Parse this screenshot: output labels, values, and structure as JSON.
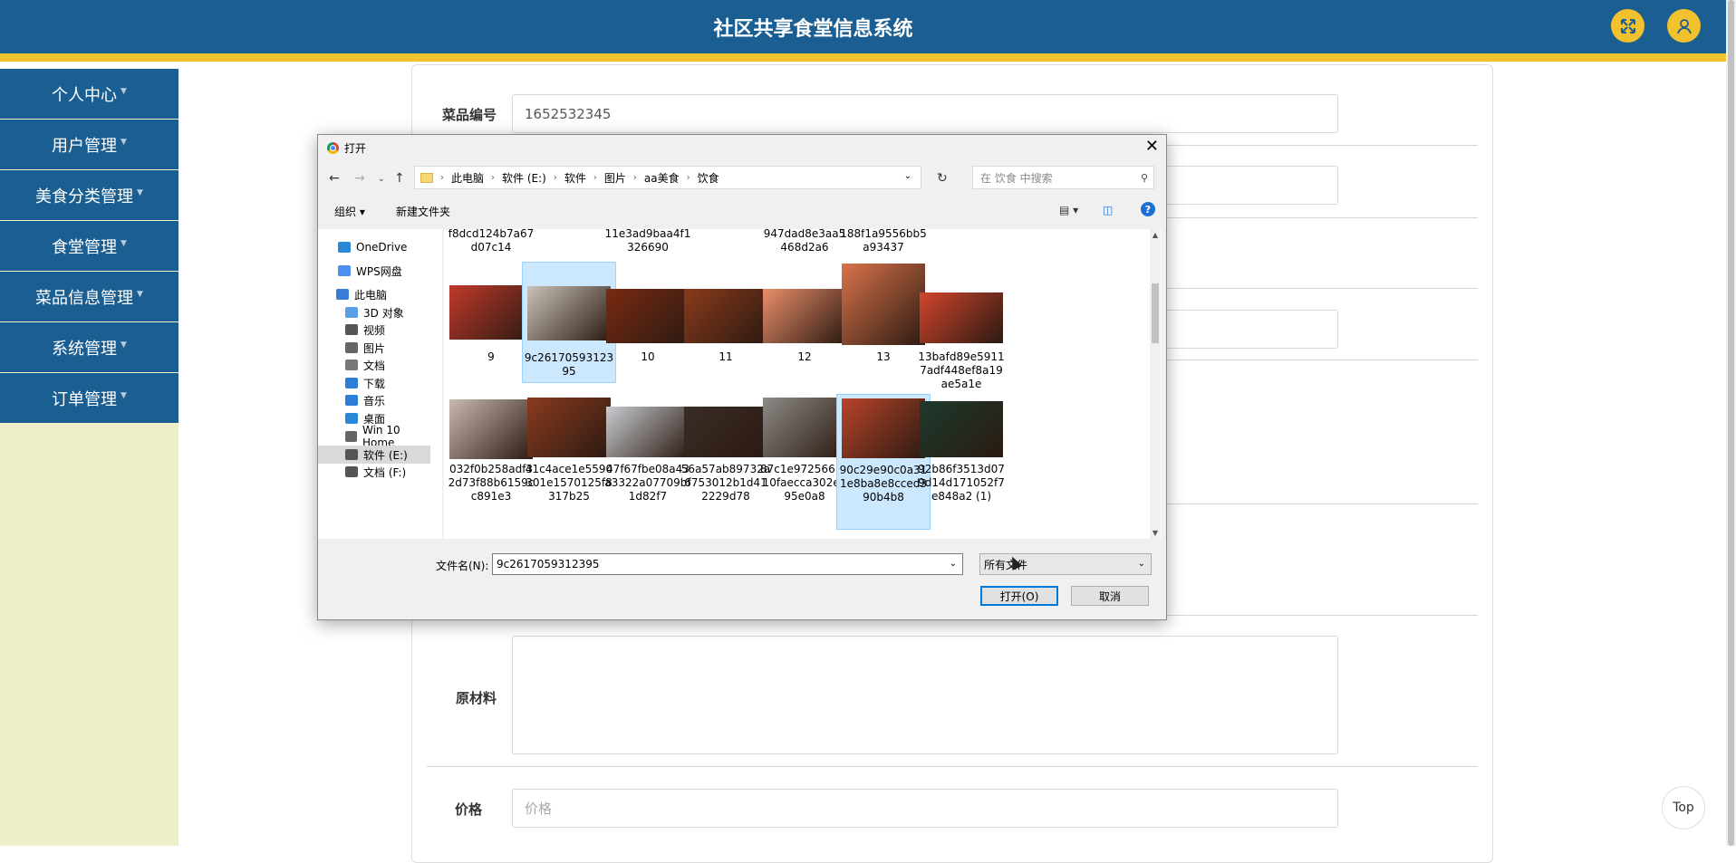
{
  "app": {
    "title": "社区共享食堂信息系统"
  },
  "header": {
    "fullscreen_icon": "expand-icon",
    "user_icon": "user-icon"
  },
  "sidebar": {
    "items": [
      {
        "label": "个人中心"
      },
      {
        "label": "用户管理"
      },
      {
        "label": "美食分类管理"
      },
      {
        "label": "食堂管理"
      },
      {
        "label": "菜品信息管理"
      },
      {
        "label": "系统管理"
      },
      {
        "label": "订单管理"
      }
    ]
  },
  "form": {
    "dish_number_label": "菜品编号",
    "dish_number_value": "1652532345",
    "materials_label": "原材料",
    "price_label": "价格",
    "price_placeholder": "价格"
  },
  "top_button": {
    "label": "Top"
  },
  "dialog": {
    "title": "打开",
    "breadcrumbs": [
      "此电脑",
      "软件 (E:)",
      "软件",
      "图片",
      "aa美食",
      "饮食"
    ],
    "search_placeholder": "在 饮食 中搜索",
    "toolbar": {
      "organize": "组织",
      "new_folder": "新建文件夹"
    },
    "nav_items": [
      {
        "label": "OneDrive",
        "icon": "cloud-icon",
        "color": "#2b88d8"
      },
      {
        "label": "WPS网盘",
        "icon": "cloud-icon",
        "color": "#4b8ff0"
      },
      {
        "label": "此电脑",
        "icon": "computer-icon",
        "color": "#3a7bd5"
      },
      {
        "label": "3D 对象",
        "icon": "cube-icon",
        "color": "#5aa0e6"
      },
      {
        "label": "视频",
        "icon": "video-icon",
        "color": "#555555"
      },
      {
        "label": "图片",
        "icon": "picture-icon",
        "color": "#666666"
      },
      {
        "label": "文档",
        "icon": "document-icon",
        "color": "#777777"
      },
      {
        "label": "下载",
        "icon": "download-icon",
        "color": "#2b7fd8"
      },
      {
        "label": "音乐",
        "icon": "music-icon",
        "color": "#2b7fd8"
      },
      {
        "label": "桌面",
        "icon": "desktop-icon",
        "color": "#2b88d8"
      },
      {
        "label": "Win 10 Home",
        "icon": "network-drive-icon",
        "color": "#666666"
      },
      {
        "label": "软件 (E:)",
        "icon": "drive-icon",
        "color": "#555555"
      },
      {
        "label": "文档 (F:)",
        "icon": "drive-icon",
        "color": "#555555"
      }
    ],
    "files_row0": [
      "f8dcd124b7a67\nd07c14",
      "",
      "11e3ad9baa4f1\n326690",
      "",
      "947dad8e3aa5\n468d2a6",
      "188f1a9556bb5\na93437",
      ""
    ],
    "files_row1": [
      {
        "name": "9",
        "color": "#c0392b"
      },
      {
        "name": "9c26170593123\n95",
        "color": "#c8c2b8"
      },
      {
        "name": "10",
        "color": "#7a2a12"
      },
      {
        "name": "11",
        "color": "#8b3a1a"
      },
      {
        "name": "12",
        "color": "#e98e6a"
      },
      {
        "name": "13",
        "color": "#d9734a"
      },
      {
        "name": "13bafd89e5911\n7adf448ef8a19\nae5a1e",
        "color": "#d1452c"
      }
    ],
    "files_row2": [
      {
        "name": "032f0b258adf3\n2d73f88b6159c\nc891e3",
        "color": "#c9b9b0"
      },
      {
        "name": "41c4ace1e5590\n301e1570125f8\n317b25",
        "color": "#8a3b1f"
      },
      {
        "name": "47f67fbe08a43\na3322a07709bf\n1d82f7",
        "color": "#c8ccd0"
      },
      {
        "name": "56a57ab89732a\n6753012b1d41\n2229d78",
        "color": "#3a2c26"
      },
      {
        "name": "87c1e97256613\n10faecca302e1\n95e0a8",
        "color": "#8d8a86"
      },
      {
        "name": "90c29e90c0a31\n1e8ba8e8cced3\n90b4b8",
        "color": "#b8442a"
      },
      {
        "name": "92b86f3513d07\n9d14d171052f7\ne848a2 (1)",
        "color": "#1d3a2c"
      }
    ],
    "filename_label": "文件名(N):",
    "filename_value": "9c2617059312395",
    "filetype_value": "所有文件",
    "open_label": "打开(O)",
    "cancel_label": "取消"
  }
}
